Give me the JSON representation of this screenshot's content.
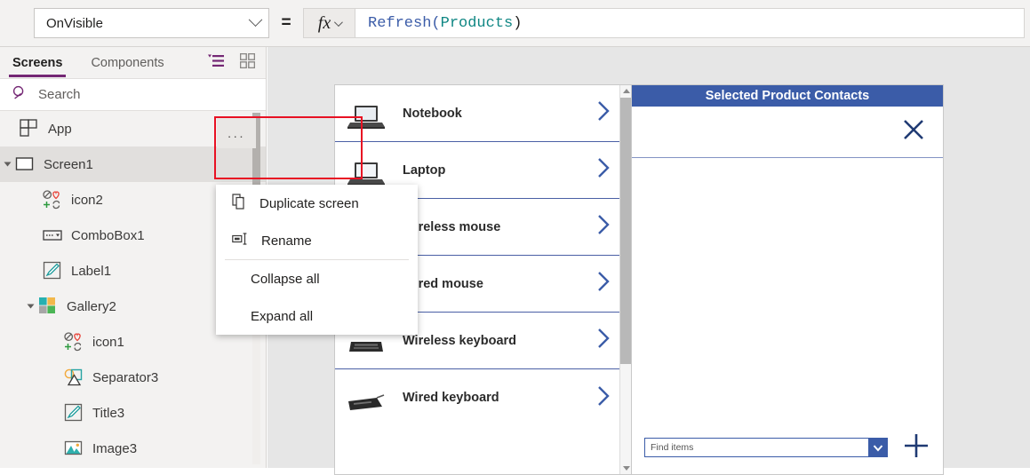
{
  "formula_bar": {
    "property_value": "OnVisible",
    "equals": "=",
    "fx_label": "fx",
    "formula_tokens": {
      "function": "Refresh(",
      "datasource": " Products ",
      "close": ")"
    },
    "dropdown_icon": "chevron-down-icon"
  },
  "sidebar": {
    "tabs": [
      {
        "label": "Screens",
        "active": true
      },
      {
        "label": "Components",
        "active": false
      }
    ],
    "view_icons": [
      {
        "name": "tree-view-icon",
        "color": "#742774",
        "active": true
      },
      {
        "name": "thumbnail-view-icon",
        "color": "#8a8886",
        "active": false
      }
    ],
    "search": {
      "placeholder": "Search",
      "value": "",
      "icon": "search-icon"
    },
    "tree": [
      {
        "label": "App",
        "icon": "app-icon",
        "indent": 0,
        "twisty": false,
        "selected": false
      },
      {
        "label": "Screen1",
        "icon": "screen-icon",
        "indent": 0,
        "twisty": true,
        "selected": true
      },
      {
        "label": "icon2",
        "icon": "icon-component-icon",
        "indent": 1,
        "twisty": false,
        "selected": false
      },
      {
        "label": "ComboBox1",
        "icon": "combobox-icon",
        "indent": 1,
        "twisty": false,
        "selected": false
      },
      {
        "label": "Label1",
        "icon": "label-icon",
        "indent": 1,
        "twisty": false,
        "selected": false
      },
      {
        "label": "Gallery2",
        "icon": "gallery-icon",
        "indent": 1,
        "twisty": true,
        "selected": false
      },
      {
        "label": "icon1",
        "icon": "icon-component-icon",
        "indent": 2,
        "twisty": false,
        "selected": false
      },
      {
        "label": "Separator3",
        "icon": "shapes-icon",
        "indent": 2,
        "twisty": false,
        "selected": false
      },
      {
        "label": "Title3",
        "icon": "label-icon",
        "indent": 2,
        "twisty": false,
        "selected": false
      },
      {
        "label": "Image3",
        "icon": "image-icon",
        "indent": 2,
        "twisty": false,
        "selected": false
      }
    ]
  },
  "context_menu": {
    "ellipsis_label": "...",
    "highlight_color": "#e81123",
    "items": [
      {
        "label": "Duplicate screen",
        "icon": "duplicate-icon",
        "has_icon": true
      },
      {
        "label": "Rename",
        "icon": "rename-icon",
        "has_icon": true
      },
      {
        "divider": true
      },
      {
        "label": "Collapse all",
        "has_icon": false
      },
      {
        "label": "Expand all",
        "has_icon": false
      }
    ]
  },
  "canvas": {
    "gallery": {
      "items": [
        {
          "title": "Notebook",
          "thumb": "laptop-thumb",
          "chevron": "chevron-right-icon"
        },
        {
          "title": "Laptop",
          "thumb": "laptop-thumb",
          "chevron": "chevron-right-icon"
        },
        {
          "title": "Wireless mouse",
          "thumb": "mouse-thumb",
          "chevron": "chevron-right-icon"
        },
        {
          "title": "Wired mouse",
          "thumb": "mouse-thumb",
          "chevron": "chevron-right-icon"
        },
        {
          "title": "Wireless keyboard",
          "thumb": "keyboard-thumb",
          "chevron": "chevron-right-icon"
        },
        {
          "title": "Wired keyboard",
          "thumb": "keyboard-thumb",
          "chevron": "chevron-right-icon"
        }
      ]
    },
    "detail_panel": {
      "title": "Selected Product Contacts",
      "header_color": "#3b5ca8",
      "close_icon": "close-icon",
      "find_combo": {
        "placeholder": "Find items",
        "value": "Find items",
        "dropdown_icon": "chevron-down-icon"
      },
      "add_icon": "plus-icon"
    }
  }
}
